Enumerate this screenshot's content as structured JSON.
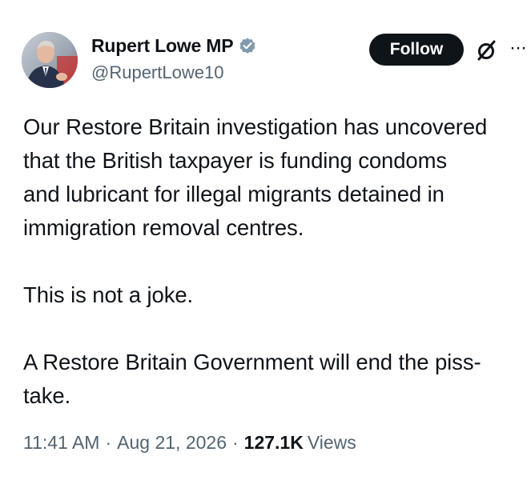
{
  "author": {
    "display_name": "Rupert Lowe MP",
    "handle": "@RupertLowe10",
    "verified_badge_icon": "verified-badge-icon",
    "badge_color": "#829aab"
  },
  "actions": {
    "follow_label": "Follow",
    "grok_icon": "grok-icon",
    "more_icon": "more-icon",
    "more_glyph": "···"
  },
  "tweet": {
    "text": "Our Restore Britain investigation has uncovered\nthat the British taxpayer is funding condoms\nand lubricant for illegal migrants detained in\nimmigration removal centres.\n\nThis is not a joke.\n\nA Restore Britain Government will end the piss-\ntake."
  },
  "meta": {
    "time": "11:41 AM",
    "separator": "·",
    "date": "Aug 21, 2026",
    "views_count": "127.1K",
    "views_label": "Views"
  },
  "colors": {
    "text_primary": "#0f1419",
    "text_secondary": "#536471",
    "button_bg": "#0f1419"
  }
}
